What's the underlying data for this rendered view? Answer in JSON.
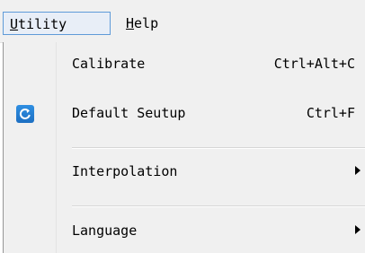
{
  "menubar": {
    "utility": {
      "mnemonic": "U",
      "rest": "tility"
    },
    "help": {
      "mnemonic": "H",
      "rest": "elp"
    }
  },
  "utility_menu": {
    "items": [
      {
        "label": "Calibrate",
        "shortcut": "Ctrl+Alt+C"
      },
      {
        "label": "Default Seutup",
        "shortcut": "Ctrl+F",
        "icon": "reset-icon"
      },
      {
        "label": "Interpolation",
        "submenu": true
      },
      {
        "label": "Language",
        "submenu": true
      }
    ]
  },
  "colors": {
    "menu_highlight_border": "#5f9bd8",
    "icon_blue": "#1d6fc2"
  }
}
